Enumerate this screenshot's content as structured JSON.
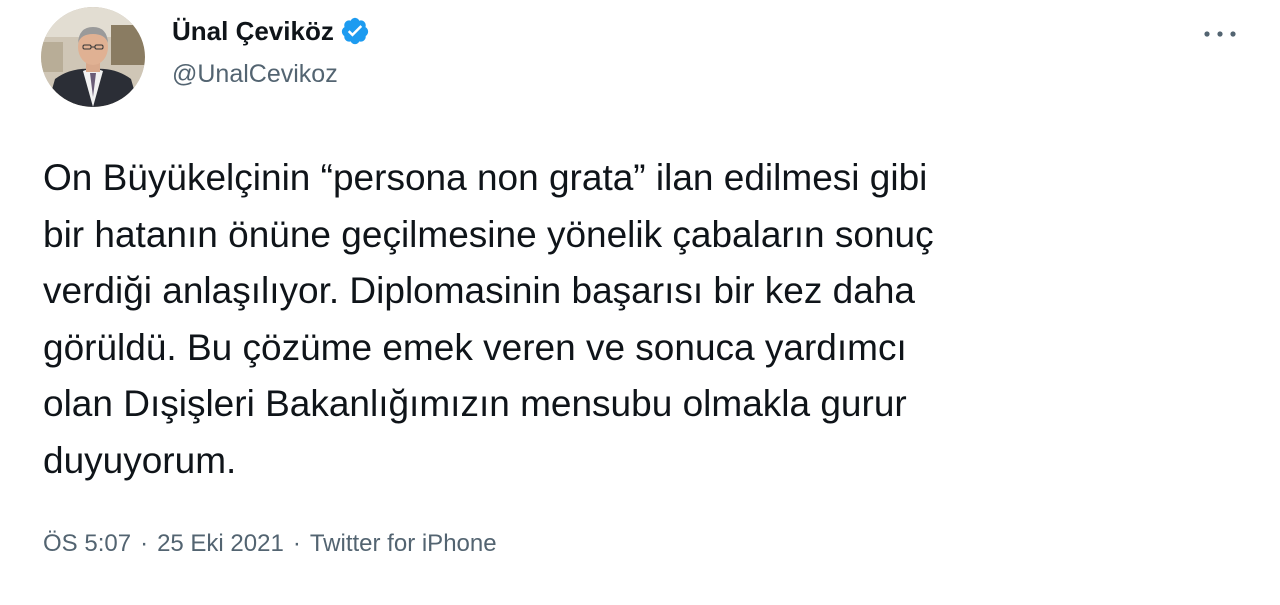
{
  "tweet": {
    "author": {
      "display_name": "Ünal Çeviköz",
      "handle": "@UnalCevikoz",
      "verified": true,
      "verified_color": "#1d9bf0"
    },
    "more_icon": "more-horizontal-icon",
    "text": "On Büyükelçinin “persona non grata” ilan edilmesi gibi\nbir hatanın önüne geçilmesine yönelik çabaların sonuç\nverdiği anlaşılıyor. Diplomasinin başarısı bir kez daha\ngörüldü. Bu çözüme emek veren ve sonuca yardımcı\nolan Dışişleri Bakanlığımızın mensubu olmakla gurur\nduyuyorum.",
    "meta": {
      "time": "ÖS 5:07",
      "date": "25 Eki 2021",
      "source": "Twitter for iPhone",
      "separator": "·"
    }
  },
  "colors": {
    "text_primary": "#0f1419",
    "text_secondary": "#536471",
    "background": "#ffffff"
  }
}
